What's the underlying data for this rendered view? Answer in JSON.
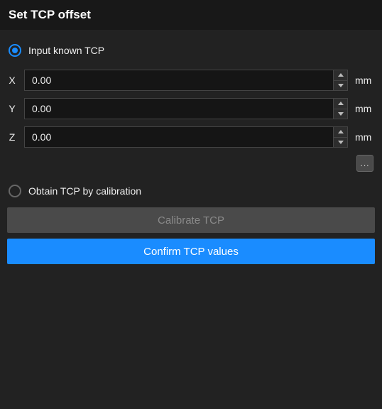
{
  "title": "Set TCP offset",
  "option_input_known": {
    "label": "Input known TCP",
    "selected": true
  },
  "option_calibration": {
    "label": "Obtain TCP by calibration",
    "selected": false
  },
  "fields": {
    "x": {
      "label": "X",
      "value": "0.00",
      "unit": "mm"
    },
    "y": {
      "label": "Y",
      "value": "0.00",
      "unit": "mm"
    },
    "z": {
      "label": "Z",
      "value": "0.00",
      "unit": "mm"
    }
  },
  "more_button": "...",
  "calibrate_button": "Calibrate TCP",
  "confirm_button": "Confirm TCP values"
}
